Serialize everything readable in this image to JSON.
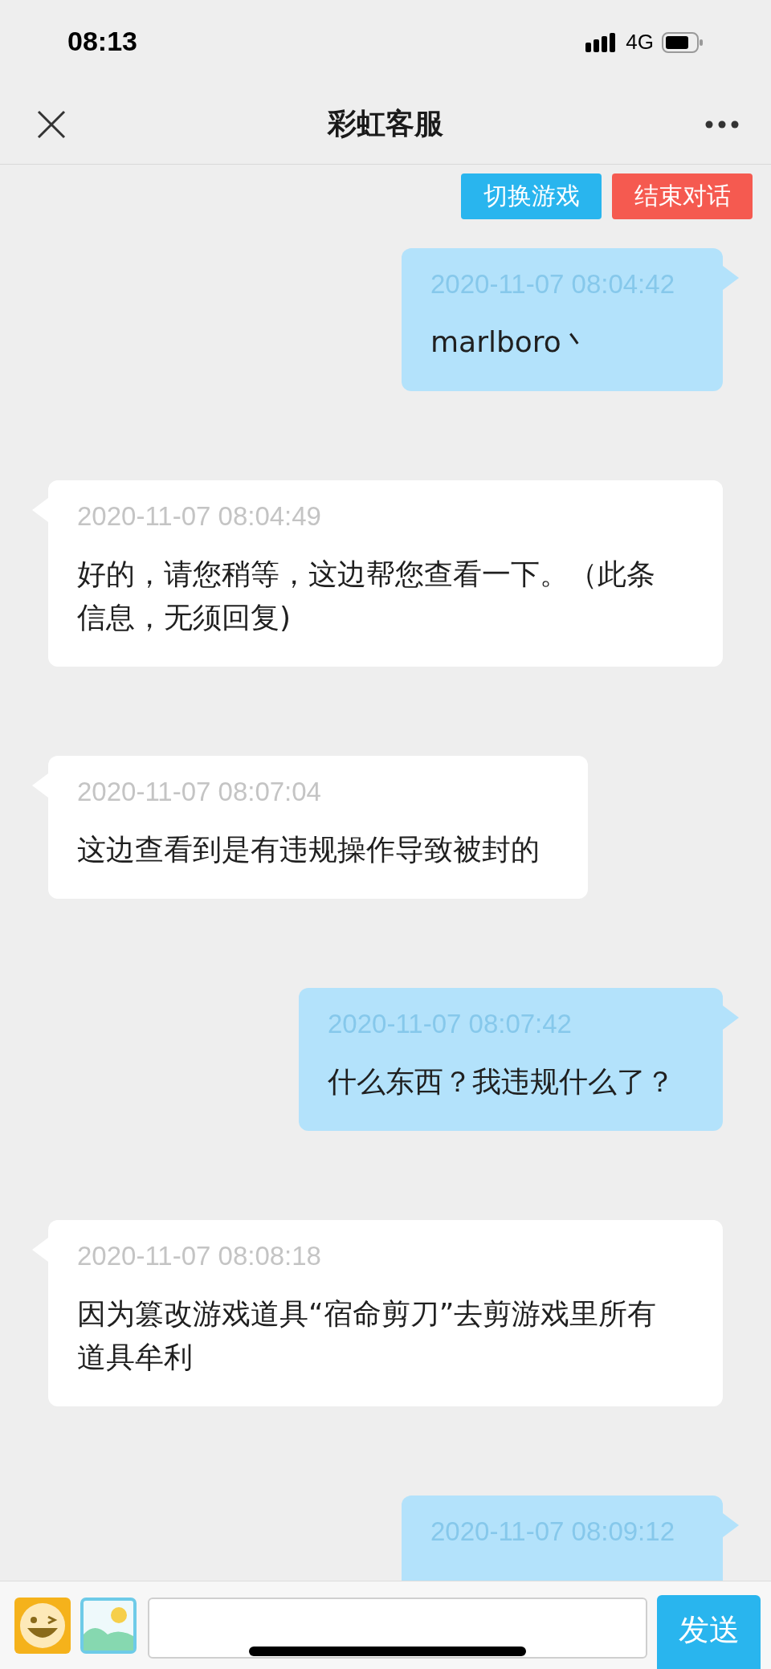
{
  "status_bar": {
    "time": "08:13",
    "network": "4G"
  },
  "nav": {
    "title": "彩虹客服"
  },
  "actions": [
    {
      "label": "切换游戏",
      "color": "#29b5ee"
    },
    {
      "label": "结束对话",
      "color": "#f55a50"
    }
  ],
  "messages": [
    {
      "kind": "sent",
      "time": "2020-11-07 08:04:42",
      "text": "marlboro丶"
    },
    {
      "kind": "received",
      "time": "2020-11-07 08:04:49",
      "text": "好的，请您稍等，这边帮您查看一下。（此条信息，无须回复)"
    },
    {
      "kind": "received",
      "time": "2020-11-07 08:07:04",
      "text": "这边查看到是有违规操作导致被封的"
    },
    {
      "kind": "sent",
      "time": "2020-11-07 08:07:42",
      "text": "什么东西？我违规什么了？"
    },
    {
      "kind": "received",
      "time": "2020-11-07 08:08:18",
      "text": "因为篡改游戏道具“宿命剪刀”去剪游戏里所有道具牟利"
    },
    {
      "kind": "sent",
      "time": "2020-11-07 08:09:12"
    }
  ],
  "composer": {
    "send": "发送"
  }
}
